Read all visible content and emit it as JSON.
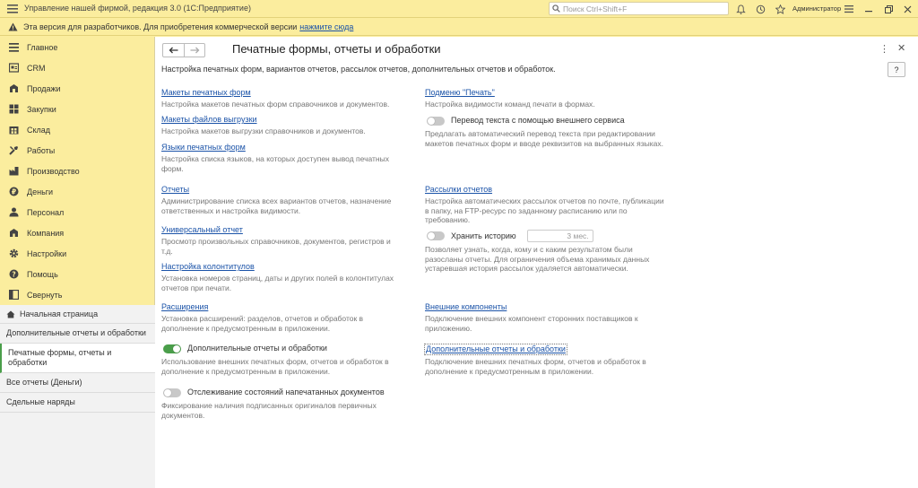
{
  "titlebar": {
    "title": "Управление нашей фирмой, редакция 3.0  (1С:Предприятие)",
    "search_placeholder": "Поиск Ctrl+Shift+F",
    "user": "Администратор"
  },
  "warning": {
    "text": "Эта версия для разработчиков. Для приобретения коммерческой версии",
    "link": "нажмите сюда"
  },
  "sidebar": {
    "items": [
      {
        "label": "Главное",
        "icon": "menu-icon"
      },
      {
        "label": "CRM",
        "icon": "crm-icon"
      },
      {
        "label": "Продажи",
        "icon": "sales-icon"
      },
      {
        "label": "Закупки",
        "icon": "purchases-icon"
      },
      {
        "label": "Склад",
        "icon": "warehouse-icon"
      },
      {
        "label": "Работы",
        "icon": "works-icon"
      },
      {
        "label": "Производство",
        "icon": "production-icon"
      },
      {
        "label": "Деньги",
        "icon": "money-icon"
      },
      {
        "label": "Персонал",
        "icon": "staff-icon"
      },
      {
        "label": "Компания",
        "icon": "company-icon"
      },
      {
        "label": "Настройки",
        "icon": "settings-icon"
      },
      {
        "label": "Помощь",
        "icon": "help-icon"
      },
      {
        "label": "Свернуть",
        "icon": "collapse-icon"
      }
    ],
    "open_pages": [
      {
        "label": "Начальная страница"
      },
      {
        "label": "Дополнительные отчеты и обработки"
      },
      {
        "label": "Печатные формы, отчеты и обработки"
      },
      {
        "label": "Все отчеты (Деньги)"
      },
      {
        "label": "Сдельные наряды"
      }
    ]
  },
  "main": {
    "title": "Печатные формы, отчеты и обработки",
    "description": "Настройка печатных форм, вариантов отчетов, рассылок отчетов, дополнительных отчетов и обработок.",
    "help_label": "?",
    "left": [
      {
        "link": "Макеты печатных форм",
        "note": "Настройка макетов печатных форм справочников и документов."
      },
      {
        "link": "Макеты файлов выгрузки",
        "note": "Настройка макетов выгрузки справочников и документов."
      },
      {
        "link": "Языки печатных форм",
        "note": "Настройка списка языков, на которых доступен вывод печатных форм."
      },
      {
        "link": "Отчеты",
        "note": "Администрирование списка всех вариантов отчетов, назначение ответственных и настройка видимости."
      },
      {
        "link": "Универсальный отчет",
        "note": "Просмотр произвольных справочников, документов, регистров и т.д."
      },
      {
        "link": "Настройка колонтитулов",
        "note": "Установка номеров страниц, даты и других полей в колонтитулах отчетов при печати."
      },
      {
        "link": "Расширения",
        "note": "Установка расширений: разделов, отчетов и обработок в дополнение к предусмотренным в приложении."
      }
    ],
    "left_toggles": [
      {
        "label": "Дополнительные отчеты и обработки",
        "note": "Использование внешних печатных форм, отчетов и обработок в дополнение к предусмотренным в приложении."
      },
      {
        "label": "Отслеживание состояний напечатанных документов",
        "note": "Фиксирование наличия подписанных оригиналов первичных документов."
      }
    ],
    "right": {
      "print_menu": {
        "link": "Подменю \"Печать\"",
        "note": "Настройка видимости команд печати в формах."
      },
      "translate": {
        "label": "Перевод текста с помощью внешнего сервиса",
        "note": "Предлагать автоматический перевод текста при редактировании макетов печатных форм и вводе реквизитов на выбранных языках."
      },
      "mailing": {
        "link": "Рассылки отчетов",
        "note": "Настройка автоматических рассылок отчетов по почте, публикации в папку, на FTP-ресурс по заданному расписанию или по требованию."
      },
      "history": {
        "label": "Хранить историю",
        "value": "3 мес.",
        "note": "Позволяет узнать, когда, кому и с каким результатом были разосланы отчеты. Для ограничения объема хранимых данных устаревшая история рассылок удаляется автоматически."
      },
      "ext_components": {
        "link": "Внешние компоненты",
        "note": "Подключение внешних компонент сторонних поставщиков к приложению."
      },
      "add_reports": {
        "link": "Дополнительные отчеты и обработки",
        "note": "Подключение внешних печатных форм, отчетов и обработок в дополнение к предусмотренным в приложении."
      }
    }
  }
}
